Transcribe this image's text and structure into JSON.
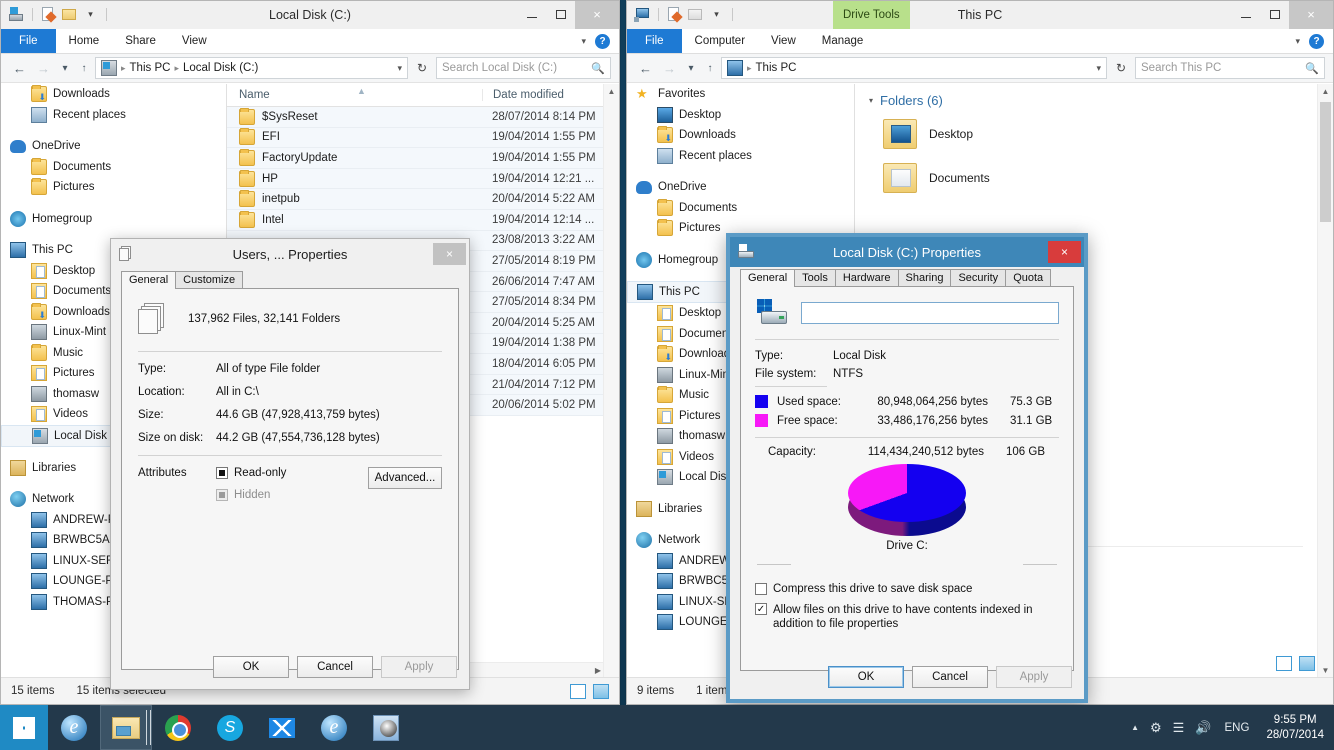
{
  "desktop": {
    "bg_color": "#0e3d59"
  },
  "left_window": {
    "title": "Local Disk (C:)",
    "quick_access_icons": [
      "drive-icon",
      "properties-icon",
      "new-folder-icon",
      "customize-chevron-icon"
    ],
    "controls": {
      "minimize": "–",
      "maximize": "☐",
      "close": "×"
    },
    "ribbon_tabs": [
      {
        "label": "File",
        "active": true
      },
      {
        "label": "Home",
        "active": false
      },
      {
        "label": "Share",
        "active": false
      },
      {
        "label": "View",
        "active": false
      }
    ],
    "address": {
      "root": "This PC",
      "current": "Local Disk (C:)"
    },
    "search_placeholder": "Search Local Disk (C:)",
    "nav_tree": [
      {
        "label": "Downloads",
        "icon": "folder-download-icon",
        "indent": true
      },
      {
        "label": "Recent places",
        "icon": "recent-places-icon",
        "indent": true
      },
      {
        "gap": true
      },
      {
        "label": "OneDrive",
        "icon": "onedrive-cloud-icon",
        "indent": false
      },
      {
        "label": "Documents",
        "icon": "folder-icon",
        "indent": true
      },
      {
        "label": "Pictures",
        "icon": "folder-icon",
        "indent": true
      },
      {
        "gap": true
      },
      {
        "label": "Homegroup",
        "icon": "homegroup-icon",
        "indent": false
      },
      {
        "gap": true
      },
      {
        "label": "This PC",
        "icon": "this-pc-icon",
        "indent": false
      },
      {
        "label": "Desktop",
        "icon": "folder-desktop-icon",
        "indent": true
      },
      {
        "label": "Documents",
        "icon": "folder-documents-icon",
        "indent": true
      },
      {
        "label": "Downloads",
        "icon": "folder-download-icon",
        "indent": true
      },
      {
        "label": "Linux-Mint",
        "icon": "user-folder-icon",
        "indent": true
      },
      {
        "label": "Music",
        "icon": "folder-music-icon",
        "indent": true
      },
      {
        "label": "Pictures",
        "icon": "folder-pictures-icon",
        "indent": true
      },
      {
        "label": "thomasw",
        "icon": "user-folder-icon",
        "indent": true
      },
      {
        "label": "Videos",
        "icon": "folder-videos-icon",
        "indent": true
      },
      {
        "label": "Local Disk (C:)",
        "icon": "local-disk-icon",
        "indent": true,
        "selected": true
      },
      {
        "gap": true
      },
      {
        "label": "Libraries",
        "icon": "libraries-icon",
        "indent": false
      },
      {
        "gap": true
      },
      {
        "label": "Network",
        "icon": "network-icon",
        "indent": false
      },
      {
        "label": "ANDREW-PC",
        "icon": "computer-icon",
        "indent": true
      },
      {
        "label": "BRWBC5A",
        "icon": "computer-icon",
        "indent": true
      },
      {
        "label": "LINUX-SERVER",
        "icon": "computer-icon",
        "indent": true
      },
      {
        "label": "LOUNGE-PC",
        "icon": "computer-icon",
        "indent": true
      },
      {
        "label": "THOMAS-PC",
        "icon": "computer-icon",
        "indent": true
      }
    ],
    "columns": [
      "Name",
      "Date modified"
    ],
    "rows": [
      {
        "name": "$SysReset",
        "date": "28/07/2014 8:14 PM"
      },
      {
        "name": "EFI",
        "date": "19/04/2014 1:55 PM"
      },
      {
        "name": "FactoryUpdate",
        "date": "19/04/2014 1:55 PM"
      },
      {
        "name": "HP",
        "date": "19/04/2014 12:21 ..."
      },
      {
        "name": "inetpub",
        "date": "20/04/2014 5:22 AM"
      },
      {
        "name": "Intel",
        "date": "19/04/2014 12:14 ..."
      },
      {
        "name": "",
        "date": "23/08/2013 3:22 AM"
      },
      {
        "name": "",
        "date": "27/05/2014 8:19 PM"
      },
      {
        "name": "",
        "date": "26/06/2014 7:47 AM"
      },
      {
        "name": "",
        "date": "27/05/2014 8:34 PM"
      },
      {
        "name": "",
        "date": "20/04/2014 5:25 AM"
      },
      {
        "name": "",
        "date": "19/04/2014 1:38 PM"
      },
      {
        "name": "",
        "date": "18/04/2014 6:05 PM"
      },
      {
        "name": "",
        "date": "21/04/2014 7:12 PM"
      },
      {
        "name": "",
        "date": "20/06/2014 5:02 PM"
      }
    ],
    "status": {
      "count": "15 items",
      "selected": "15 items selected"
    }
  },
  "right_window": {
    "title": "This PC",
    "context_tab": "Drive Tools",
    "controls": {
      "minimize": "–",
      "maximize": "☐",
      "close": "×"
    },
    "ribbon_tabs": [
      {
        "label": "File",
        "active": true
      },
      {
        "label": "Computer",
        "active": false
      },
      {
        "label": "View",
        "active": false
      },
      {
        "label": "Manage",
        "active": false
      }
    ],
    "address": {
      "current": "This PC"
    },
    "search_placeholder": "Search This PC",
    "nav_tree": [
      {
        "label": "Favorites",
        "icon": "favorites-star-icon",
        "indent": false
      },
      {
        "label": "Desktop",
        "icon": "desktop-icon",
        "indent": true
      },
      {
        "label": "Downloads",
        "icon": "folder-download-icon",
        "indent": true
      },
      {
        "label": "Recent places",
        "icon": "recent-places-icon",
        "indent": true
      },
      {
        "gap": true
      },
      {
        "label": "OneDrive",
        "icon": "onedrive-cloud-icon",
        "indent": false
      },
      {
        "label": "Documents",
        "icon": "folder-icon",
        "indent": true
      },
      {
        "label": "Pictures",
        "icon": "folder-icon",
        "indent": true
      },
      {
        "gap": true
      },
      {
        "label": "Homegroup",
        "icon": "homegroup-icon",
        "indent": false
      },
      {
        "gap": true
      },
      {
        "label": "This PC",
        "icon": "this-pc-icon",
        "indent": false,
        "selected": true
      },
      {
        "label": "Desktop",
        "icon": "folder-desktop-icon",
        "indent": true
      },
      {
        "label": "Documents",
        "icon": "folder-documents-icon",
        "indent": true
      },
      {
        "label": "Downloads",
        "icon": "folder-download-icon",
        "indent": true
      },
      {
        "label": "Linux-Mint",
        "icon": "user-folder-icon",
        "indent": true
      },
      {
        "label": "Music",
        "icon": "folder-music-icon",
        "indent": true
      },
      {
        "label": "Pictures",
        "icon": "folder-pictures-icon",
        "indent": true
      },
      {
        "label": "thomasw",
        "icon": "user-folder-icon",
        "indent": true
      },
      {
        "label": "Videos",
        "icon": "folder-videos-icon",
        "indent": true
      },
      {
        "label": "Local Disk (C:)",
        "icon": "local-disk-icon",
        "indent": true
      },
      {
        "gap": true
      },
      {
        "label": "Libraries",
        "icon": "libraries-icon",
        "indent": false
      },
      {
        "gap": true
      },
      {
        "label": "Network",
        "icon": "network-icon",
        "indent": false
      },
      {
        "label": "ANDREW-PC",
        "icon": "computer-icon",
        "indent": true
      },
      {
        "label": "BRWBC5A",
        "icon": "computer-icon",
        "indent": true
      },
      {
        "label": "LINUX-SERVER",
        "icon": "computer-icon",
        "indent": true
      },
      {
        "label": "LOUNGE-PC",
        "icon": "computer-icon",
        "indent": true
      }
    ],
    "group_header": "Folders (6)",
    "tiles": [
      {
        "label": "Desktop",
        "icon": "folder-desktop-tile-icon"
      },
      {
        "label": "Documents",
        "icon": "folder-documents-tile-icon"
      }
    ],
    "status": {
      "count": "9 items",
      "selected": "1 item selected"
    }
  },
  "users_properties_dialog": {
    "title": "Users, ... Properties",
    "icon": "stacked-files-icon",
    "close_label": "×",
    "tabs": [
      {
        "label": "General",
        "active": true
      },
      {
        "label": "Customize",
        "active": false
      }
    ],
    "summary": "137,962 Files,  32,141 Folders",
    "fields": [
      {
        "label": "Type:",
        "value": "All of type File folder"
      },
      {
        "label": "Location:",
        "value": "All in C:\\"
      },
      {
        "label": "Size:",
        "value": "44.6 GB (47,928,413,759 bytes)"
      },
      {
        "label": "Size on disk:",
        "value": "44.2 GB (47,554,736,128 bytes)"
      }
    ],
    "attributes_label": "Attributes",
    "attributes": [
      {
        "label": "Read-only",
        "state": "indeterminate",
        "dim": false
      },
      {
        "label": "Hidden",
        "state": "indeterminate",
        "dim": true
      }
    ],
    "advanced_button": "Advanced...",
    "buttons": [
      {
        "label": "OK",
        "disabled": false
      },
      {
        "label": "Cancel",
        "disabled": false
      },
      {
        "label": "Apply",
        "disabled": true
      }
    ]
  },
  "disk_properties_dialog": {
    "title": "Local Disk (C:) Properties",
    "icon": "hard-disk-icon",
    "close_label": "×",
    "tabs": [
      {
        "label": "General",
        "active": true
      },
      {
        "label": "Tools",
        "active": false
      },
      {
        "label": "Hardware",
        "active": false
      },
      {
        "label": "Sharing",
        "active": false
      },
      {
        "label": "Security",
        "active": false
      },
      {
        "label": "Quota",
        "active": false
      }
    ],
    "volume_label_value": "",
    "fields": [
      {
        "label": "Type:",
        "value": "Local Disk"
      },
      {
        "label": "File system:",
        "value": "NTFS"
      }
    ],
    "space": [
      {
        "label": "Used space:",
        "bytes": "80,948,064,256 bytes",
        "size": "75.3 GB",
        "color": "#1400f0"
      },
      {
        "label": "Free space:",
        "bytes": "33,486,176,256 bytes",
        "size": "31.1 GB",
        "color": "#f718f7"
      }
    ],
    "capacity": {
      "label": "Capacity:",
      "bytes": "114,434,240,512 bytes",
      "size": "106 GB"
    },
    "pie_caption": "Drive C:",
    "checkboxes": [
      {
        "label": "Compress this drive to save disk space",
        "checked": false
      },
      {
        "label": "Allow files on this drive to have contents indexed in addition to file properties",
        "checked": true
      }
    ],
    "buttons": [
      {
        "label": "OK",
        "disabled": false,
        "focused": true
      },
      {
        "label": "Cancel",
        "disabled": false,
        "focused": false
      },
      {
        "label": "Apply",
        "disabled": true,
        "focused": false
      }
    ],
    "chart_data": {
      "type": "pie",
      "title": "Drive C:",
      "categories": [
        "Used space",
        "Free space"
      ],
      "values": [
        80948064256,
        33486176256
      ],
      "display_values": [
        "75.3 GB",
        "31.1 GB"
      ],
      "percentages": [
        70.7,
        29.3
      ],
      "colors": [
        "#1400f0",
        "#f718f7"
      ],
      "total_bytes": 114434240512,
      "total_display": "106 GB",
      "legend": "left",
      "grid": false
    }
  },
  "taskbar": {
    "start_label": "start-button",
    "items": [
      {
        "name": "internet-explorer-taskbar-icon",
        "running": false,
        "active": false
      },
      {
        "name": "file-explorer-taskbar-icon",
        "running": true,
        "active": true
      },
      {
        "name": "chrome-taskbar-icon",
        "running": false,
        "active": false
      },
      {
        "name": "skype-taskbar-icon",
        "running": false,
        "active": false
      },
      {
        "name": "mail-taskbar-icon",
        "running": false,
        "active": false
      },
      {
        "name": "internet-explorer-2-taskbar-icon",
        "running": false,
        "active": false
      },
      {
        "name": "media-player-taskbar-icon",
        "running": false,
        "active": false
      }
    ],
    "tray": {
      "show_hidden": "▲",
      "icons": [
        "action-center-icon",
        "network-signal-icon",
        "volume-icon"
      ],
      "language": "ENG",
      "time": "9:55 PM",
      "date": "28/07/2014"
    }
  }
}
